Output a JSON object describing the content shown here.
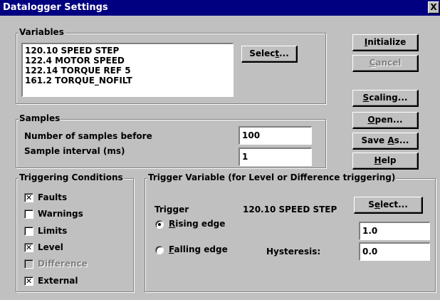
{
  "window": {
    "title": "Datalogger Settings",
    "close_glyph": "X"
  },
  "variables": {
    "legend": "Variables",
    "items": [
      "120.10 SPEED STEP",
      "122.4 MOTOR SPEED",
      "122.14 TORQUE REF 5",
      "161.2 TORQUE_NOFILT"
    ],
    "select_button": "Select..."
  },
  "side_buttons": {
    "initialize": "Initialize",
    "cancel": "Cancel",
    "scaling": "Scaling...",
    "open": "Open...",
    "save_as": "Save As...",
    "help": "Help"
  },
  "samples": {
    "legend": "Samples",
    "before_label": "Number of samples before",
    "before_value": "100",
    "interval_label": "Sample interval (ms)",
    "interval_value": "1"
  },
  "triggering": {
    "legend": "Triggering Conditions",
    "items": [
      {
        "label": "Faults",
        "checked": true,
        "enabled": true
      },
      {
        "label": "Warnings",
        "checked": false,
        "enabled": true
      },
      {
        "label": "Limits",
        "checked": false,
        "enabled": true
      },
      {
        "label": "Level",
        "checked": true,
        "enabled": true
      },
      {
        "label": "Difference",
        "checked": false,
        "enabled": false
      },
      {
        "label": "External",
        "checked": true,
        "enabled": true
      }
    ]
  },
  "trigger_variable": {
    "legend": "Trigger Variable (for Level or Difference triggering)",
    "trigger_label": "Trigger",
    "trigger_value": "120.10 SPEED STEP",
    "select_button": "Select...",
    "rising_label": "Rising edge",
    "rising_selected": true,
    "rising_value": "1.0",
    "falling_label": "Falling edge",
    "falling_selected": false,
    "hysteresis_label": "Hysteresis:",
    "hysteresis_value": "0.0"
  }
}
